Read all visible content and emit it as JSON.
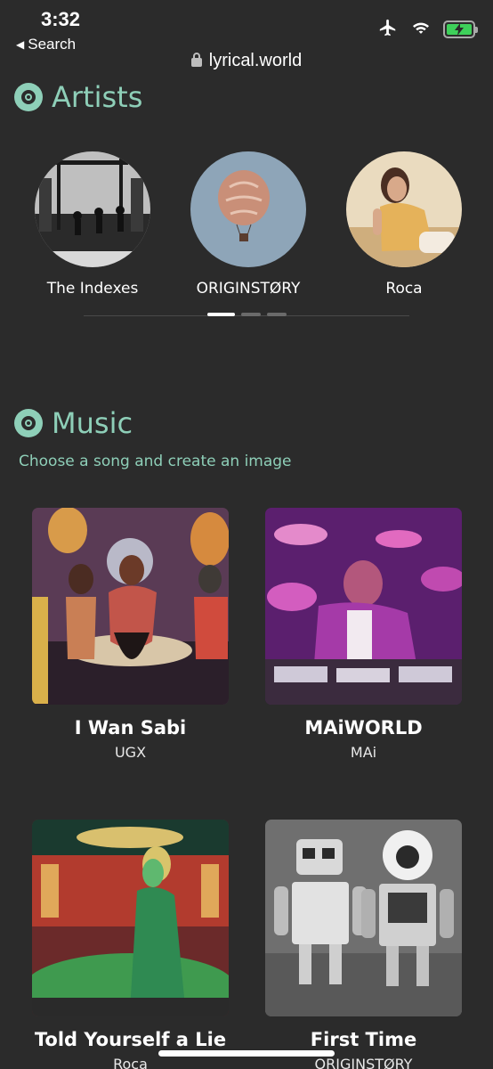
{
  "status_bar": {
    "time": "3:32",
    "back_label": "Search",
    "icons": [
      "airplane-icon",
      "wifi-icon",
      "battery-charging-icon"
    ],
    "battery_color": "#3ed05a"
  },
  "url_bar": {
    "url": "lyrical.world",
    "icon": "lock-icon"
  },
  "artists": {
    "title": "Artists",
    "items": [
      {
        "name": "The Indexes"
      },
      {
        "name": "ORIGINSTØRY"
      },
      {
        "name": "Roca"
      }
    ],
    "pagination": {
      "pages": 3,
      "active": 0
    }
  },
  "music": {
    "title": "Music",
    "subtitle": "Choose a song and create an image",
    "songs": [
      {
        "title": "I Wan Sabi",
        "artist": "UGX"
      },
      {
        "title": "MAiWORLD",
        "artist": "MAi"
      },
      {
        "title": "Told Yourself a Lie",
        "artist": "Roca"
      },
      {
        "title": "First Time",
        "artist": "ORIGINSTØRY"
      }
    ]
  },
  "colors": {
    "background": "#2b2b2b",
    "accent": "#8ecfb8",
    "text": "#ffffff"
  }
}
